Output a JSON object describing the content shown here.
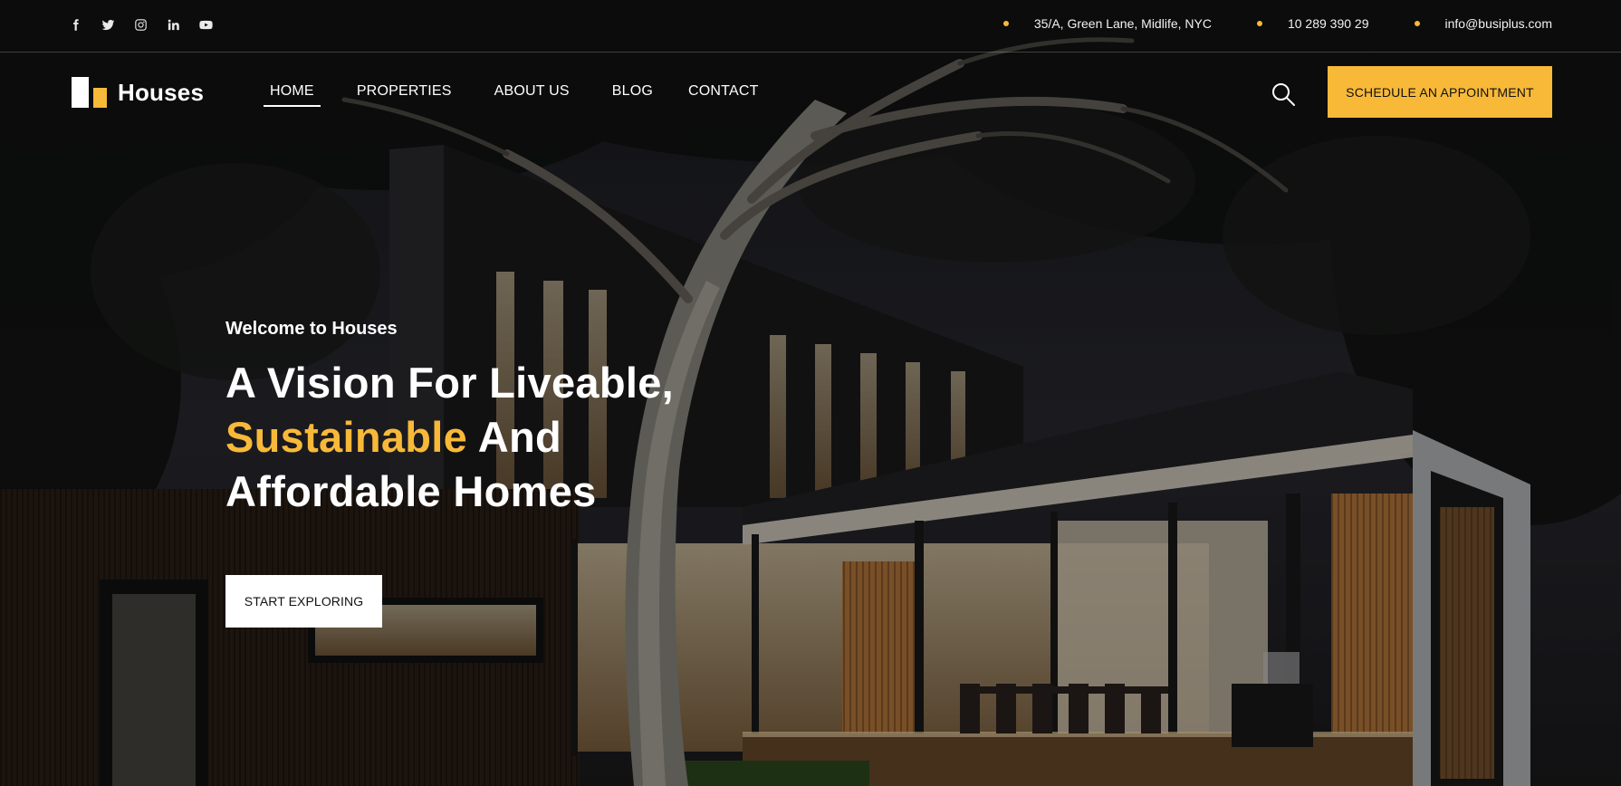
{
  "topbar": {
    "social": [
      "facebook-icon",
      "twitter-icon",
      "instagram-icon",
      "linkedin-icon",
      "youtube-icon"
    ],
    "address": "35/A, Green Lane, Midlife, NYC",
    "phone": "10 289 390 29",
    "email": "info@busiplus.com"
  },
  "brand": {
    "name": "Houses"
  },
  "nav": {
    "items": [
      {
        "label": "HOME",
        "active": true
      },
      {
        "label": "PROPERTIES",
        "active": false
      },
      {
        "label": "ABOUT US",
        "active": false
      },
      {
        "label": "BLOG",
        "active": false
      },
      {
        "label": "CONTACT",
        "active": false
      }
    ],
    "cta": "SCHEDULE AN APPOINTMENT"
  },
  "hero": {
    "eyebrow": "Welcome to Houses",
    "line1": "A Vision For Liveable,",
    "line2_highlight": "Sustainable",
    "line2_rest": " And",
    "line3": "Affordable Homes",
    "button": "START EXPLORING"
  },
  "colors": {
    "accent": "#f8b939",
    "text": "#ffffff",
    "dark": "#111111"
  }
}
